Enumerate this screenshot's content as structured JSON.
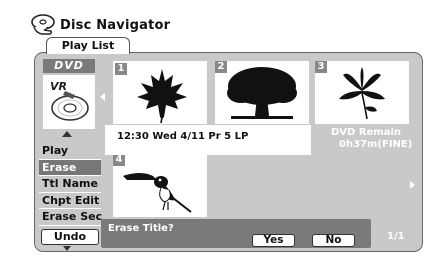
{
  "header": {
    "title": "Disc Navigator",
    "icon": "disc-hand-icon"
  },
  "tab": {
    "label": "Play List"
  },
  "disc": {
    "type_label": "DVD",
    "format_label": "VR"
  },
  "menu": {
    "items": [
      {
        "label": "Play",
        "selected": false
      },
      {
        "label": "Erase",
        "selected": true
      },
      {
        "label": "Ttl Name",
        "selected": false
      },
      {
        "label": "Chpt Edit",
        "selected": false
      },
      {
        "label": "Erase Sec",
        "selected": false
      }
    ],
    "undo_label": "Undo"
  },
  "thumbnails": [
    {
      "number": "1",
      "subject": "maple-leaf",
      "selected": true
    },
    {
      "number": "2",
      "subject": "tree",
      "selected": false
    },
    {
      "number": "3",
      "subject": "lily-flower",
      "selected": false
    },
    {
      "number": "4",
      "subject": "toucan-bird",
      "selected": false
    }
  ],
  "info": {
    "text": "12:30 Wed  4/11  Pr 5   LP"
  },
  "remain": {
    "line1": "DVD Remain",
    "line2": "0h37m(FINE)"
  },
  "confirm": {
    "prompt": "Erase Title?",
    "yes_label": "Yes",
    "no_label": "No"
  },
  "page": {
    "indicator": "1/1"
  },
  "colors": {
    "panel": "#c9c9c9",
    "highlight": "#777777",
    "bar": "#7a7a7a"
  }
}
